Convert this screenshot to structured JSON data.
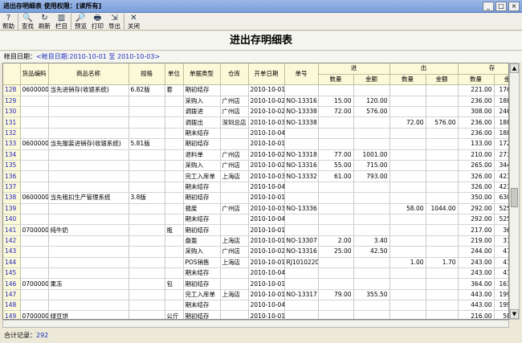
{
  "window": {
    "title": "进出存明细表  使用权限：[读所有]",
    "controls": [
      "_",
      "□",
      "×"
    ]
  },
  "toolbar": [
    {
      "name": "help",
      "label": "帮助",
      "icon": "?"
    },
    {
      "name": "search",
      "label": "查找",
      "icon": "🔍"
    },
    {
      "name": "refresh",
      "label": "刷新",
      "icon": "↻"
    },
    {
      "name": "columns",
      "label": "栏目",
      "icon": "▥"
    },
    {
      "name": "preview",
      "label": "预览",
      "icon": "🔎"
    },
    {
      "name": "print",
      "label": "打印",
      "icon": "🖶"
    },
    {
      "name": "export",
      "label": "导出",
      "icon": "⇲"
    },
    {
      "name": "close",
      "label": "关闭",
      "icon": "✕"
    }
  ],
  "report": {
    "title": "进出存明细表",
    "date_label": "帐目日期：",
    "date_value": "<帐目日期:2010-10-01 至 2010-10-03>"
  },
  "headers": {
    "row1": [
      "",
      "货品编码",
      "商品名称",
      "规格",
      "单位",
      "单据类型",
      "仓库",
      "开单日期",
      "单号",
      "进",
      "出",
      "存"
    ],
    "sub": [
      "数量",
      "金额",
      "数量",
      "金额",
      "数量",
      "金额"
    ]
  },
  "rows": [
    [
      "128",
      "06000001",
      "当先进销存(收银系统)",
      "6.82版",
      "套",
      "期初结存",
      "",
      "2010-10-01",
      "",
      "",
      "",
      "",
      "",
      "221.00",
      "1768.00"
    ],
    [
      "129",
      "",
      "",
      "",
      "",
      "采购入",
      "广州店",
      "2010-10-02",
      "NO-13316",
      "15.00",
      "120.00",
      "",
      "",
      "236.00",
      "1888.00"
    ],
    [
      "130",
      "",
      "",
      "",
      "",
      "调拨进",
      "广州店",
      "2010-10-02",
      "NO-13338",
      "72.00",
      "576.00",
      "",
      "",
      "308.00",
      "2464.00"
    ],
    [
      "131",
      "",
      "",
      "",
      "",
      "调拨出",
      "深圳总店",
      "2010-10-03",
      "NO-13338",
      "",
      "",
      "72.00",
      "576.00",
      "236.00",
      "1888.00"
    ],
    [
      "132",
      "",
      "",
      "",
      "",
      "期末结存",
      "",
      "2010-10-04",
      "",
      "",
      "",
      "",
      "",
      "236.00",
      "1888.00"
    ],
    [
      "133",
      "06000002",
      "当先服装进销存(收银系统)",
      "5.81版",
      "",
      "期初结存",
      "",
      "2010-10-01",
      "",
      "",
      "",
      "",
      "",
      "133.00",
      "1729.00"
    ],
    [
      "134",
      "",
      "",
      "",
      "",
      "退料单",
      "广州店",
      "2010-10-02",
      "NO-13318",
      "77.00",
      "1001.00",
      "",
      "",
      "210.00",
      "2730.00"
    ],
    [
      "135",
      "",
      "",
      "",
      "",
      "采购入",
      "广州店",
      "2010-10-02",
      "NO-13316",
      "55.00",
      "715.00",
      "",
      "",
      "265.00",
      "3445.00"
    ],
    [
      "136",
      "",
      "",
      "",
      "",
      "完工入库单",
      "上海店",
      "2010-10-03",
      "NO-13332",
      "61.00",
      "793.00",
      "",
      "",
      "326.00",
      "4238.00"
    ],
    [
      "137",
      "",
      "",
      "",
      "",
      "期末结存",
      "",
      "2010-10-04",
      "",
      "",
      "",
      "",
      "",
      "326.00",
      "4238.00"
    ],
    [
      "138",
      "06000003",
      "当先租扣生产管理系统",
      "3.8版",
      "",
      "期初结存",
      "",
      "2010-10-01",
      "",
      "",
      "",
      "",
      "",
      "350.00",
      "6300.00"
    ],
    [
      "139",
      "",
      "",
      "",
      "",
      "报废",
      "广州店",
      "2010-10-03",
      "NO-13336",
      "",
      "",
      "58.00",
      "1044.00",
      "292.00",
      "5256.00"
    ],
    [
      "140",
      "",
      "",
      "",
      "",
      "期末结存",
      "",
      "2010-10-04",
      "",
      "",
      "",
      "",
      "",
      "292.00",
      "5256.00"
    ],
    [
      "141",
      "07000001",
      "纯牛奶",
      "",
      "瓶",
      "期初结存",
      "",
      "2010-10-01",
      "",
      "",
      "",
      "",
      "",
      "217.00",
      "368.90"
    ],
    [
      "142",
      "",
      "",
      "",
      "",
      "盘盈",
      "上海店",
      "2010-10-01",
      "NO-13307",
      "2.00",
      "3.40",
      "",
      "",
      "219.00",
      "372.30"
    ],
    [
      "143",
      "",
      "",
      "",
      "",
      "采购入",
      "广州店",
      "2010-10-02",
      "NO-13316",
      "25.00",
      "42.50",
      "",
      "",
      "244.00",
      "414.80"
    ],
    [
      "144",
      "",
      "",
      "",
      "",
      "POS销售",
      "上海店",
      "2010-10-01",
      "RJ1010220",
      "",
      "",
      "1.00",
      "1.70",
      "243.00",
      "413.10"
    ],
    [
      "145",
      "",
      "",
      "",
      "",
      "期末结存",
      "",
      "2010-10-04",
      "",
      "",
      "",
      "",
      "",
      "243.00",
      "413.10"
    ],
    [
      "146",
      "07000002",
      "果冻",
      "",
      "包",
      "期初结存",
      "",
      "2010-10-01",
      "",
      "",
      "",
      "",
      "",
      "364.00",
      "1638.00"
    ],
    [
      "147",
      "",
      "",
      "",
      "",
      "完工入库单",
      "上海店",
      "2010-10-01",
      "NO-13317",
      "79.00",
      "355.50",
      "",
      "",
      "443.00",
      "1993.50"
    ],
    [
      "148",
      "",
      "",
      "",
      "",
      "期末结存",
      "",
      "2010-10-04",
      "",
      "",
      "",
      "",
      "",
      "443.00",
      "1993.50"
    ],
    [
      "149",
      "07000003",
      "绿豆饼",
      "",
      "公斤",
      "期初结存",
      "",
      "2010-10-01",
      "",
      "",
      "",
      "",
      "",
      "216.00",
      "583.20"
    ],
    [
      "150",
      "",
      "",
      "",
      "",
      "盘盈",
      "上海店",
      "2010-10-01",
      "NO-13307",
      "108.00",
      "291.60",
      "",
      "",
      "324.00",
      "874.80"
    ]
  ],
  "status": {
    "label": "合计记录：",
    "count": "292"
  }
}
